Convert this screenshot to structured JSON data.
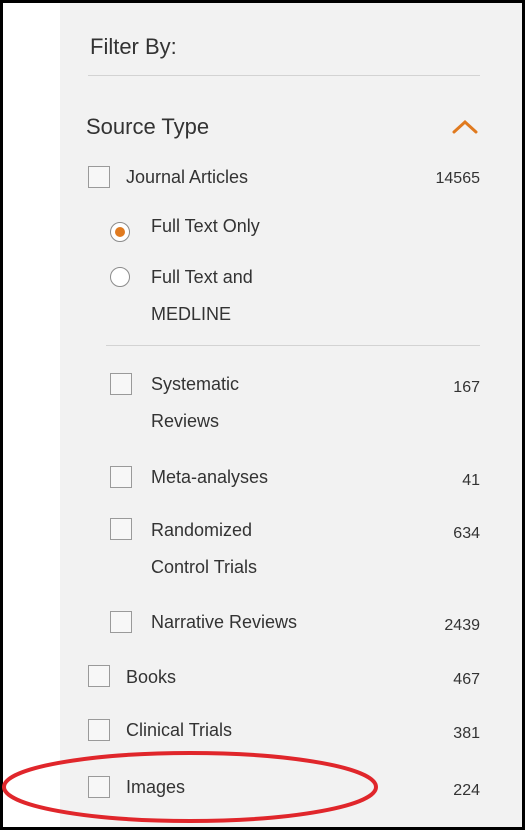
{
  "filter": {
    "title": "Filter By:",
    "source_type": {
      "heading": "Source Type",
      "toggle_icon": "chevron-up-icon",
      "accent_color": "#e07a1f"
    },
    "journal_articles": {
      "label": "Journal Articles",
      "count": "14565",
      "checked": false
    },
    "text_options": [
      {
        "label": "Full Text Only",
        "selected": true
      },
      {
        "label_line1": "Full Text and",
        "label_line2": "MEDLINE",
        "selected": false
      }
    ],
    "sub_types": [
      {
        "line1": "Systematic",
        "line2": "Reviews",
        "count": "167"
      },
      {
        "line1": "Meta-analyses",
        "count": "41"
      },
      {
        "line1": "Randomized",
        "line2": "Control Trials",
        "count": "634"
      },
      {
        "line1": "Narrative Reviews",
        "count": "2439"
      }
    ],
    "other_types": [
      {
        "label": "Books",
        "count": "467"
      },
      {
        "label": "Clinical Trials",
        "count": "381"
      },
      {
        "label": "Images",
        "count": "224"
      }
    ],
    "highlight_color": "#e0262b"
  }
}
